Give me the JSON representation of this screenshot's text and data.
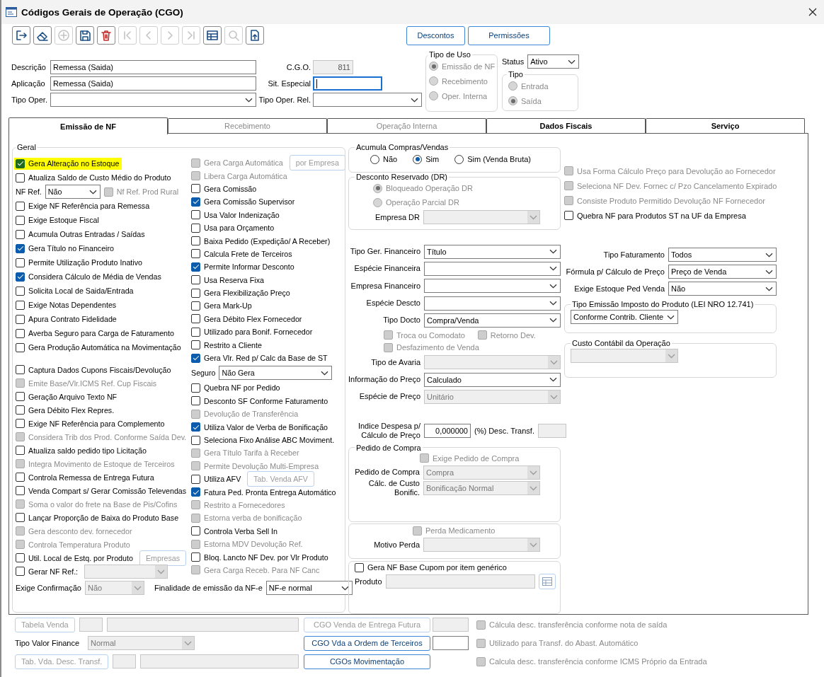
{
  "window": {
    "title": "Códigos Gerais de Operação (CGO)"
  },
  "toolbar": [
    {
      "kind": "exit",
      "disabled": false
    },
    {
      "kind": "eraser",
      "disabled": false
    },
    {
      "kind": "add",
      "disabled": true
    },
    {
      "kind": "save",
      "disabled": false
    },
    {
      "kind": "delete",
      "disabled": false
    },
    {
      "kind": "first",
      "disabled": true
    },
    {
      "kind": "prev",
      "disabled": true
    },
    {
      "kind": "next",
      "disabled": true
    },
    {
      "kind": "last",
      "disabled": true
    },
    {
      "kind": "grid",
      "disabled": false
    },
    {
      "kind": "search",
      "disabled": true
    },
    {
      "kind": "export",
      "disabled": false
    }
  ],
  "header_buttons": [
    {
      "label": "Descontos"
    },
    {
      "label": "Permissões"
    }
  ],
  "header": {
    "descricao": {
      "label": "Descrição",
      "value": "Remessa (Saida)"
    },
    "aplicacao": {
      "label": "Aplicação",
      "value": "Remessa (Saida)"
    },
    "tipo_oper": {
      "label": "Tipo Oper."
    },
    "cgo": {
      "label": "C.G.O.",
      "value": "811",
      "disabled": true
    },
    "sit_especial": {
      "label": "Sit. Especial",
      "focused": true
    },
    "tipo_oper_rel": {
      "label": "Tipo Oper. Rel."
    },
    "tipo_de_uso": {
      "title": "Tipo de Uso",
      "disabled": true,
      "options": [
        {
          "label": "Emissão de NF",
          "selected": true
        },
        {
          "label": "Recebimento",
          "selected": false
        },
        {
          "label": "Oper. Interna",
          "selected": false
        }
      ]
    },
    "status": {
      "label": "Status",
      "value": "Ativo"
    },
    "tipo": {
      "title": "Tipo",
      "disabled": true,
      "options": [
        {
          "label": "Entrada",
          "selected": false
        },
        {
          "label": "Saída",
          "selected": true
        }
      ]
    }
  },
  "tabs": [
    {
      "label": "Emissão de NF",
      "selected": true,
      "disabled": false
    },
    {
      "label": "Recebimento",
      "selected": false,
      "disabled": true
    },
    {
      "label": "Operação Interna",
      "selected": false,
      "disabled": true
    },
    {
      "label": "Dados Fiscais",
      "selected": false,
      "disabled": false
    },
    {
      "label": "Serviço",
      "selected": false,
      "disabled": false
    }
  ],
  "geral": {
    "title": "Geral",
    "column_1": [
      {
        "kind": "check",
        "label": "Gera Alteração no Estoque",
        "checked": true,
        "disabled": false,
        "highlighted": true
      },
      {
        "kind": "check",
        "label": "Atualiza Saldo de Custo Médio do Produto",
        "checked": false,
        "disabled": false,
        "highlighted": false
      },
      {
        "kind": "combo",
        "label": "NF Ref.",
        "value": "Não",
        "disabled": false,
        "check": {
          "label": "Nf Ref. Prod Rural",
          "checked": false,
          "disabled": true
        }
      },
      {
        "kind": "check",
        "label": "Exige NF Referência para Remessa",
        "checked": false,
        "disabled": false,
        "highlighted": false
      },
      {
        "kind": "check",
        "label": "Exige Estoque Fiscal",
        "checked": false,
        "disabled": false,
        "highlighted": false
      },
      {
        "kind": "check",
        "label": "Acumula Outras Entradas / Saídas",
        "checked": false,
        "disabled": false,
        "highlighted": false
      },
      {
        "kind": "check",
        "label": "Gera Título no Financeiro",
        "checked": true,
        "disabled": false,
        "highlighted": false
      },
      {
        "kind": "check",
        "label": "Permite Utilização Produto Inativo",
        "checked": false,
        "disabled": false,
        "highlighted": false
      },
      {
        "kind": "check",
        "label": "Considera Cálculo de Média de Vendas",
        "checked": true,
        "disabled": false,
        "highlighted": false
      },
      {
        "kind": "check",
        "label": "Solicita Local de Saida/Entrada",
        "checked": false,
        "disabled": false,
        "highlighted": false
      },
      {
        "kind": "check",
        "label": "Exige Notas Dependentes",
        "checked": false,
        "disabled": false,
        "highlighted": false
      },
      {
        "kind": "check",
        "label": "Apura Contrato Fidelidade",
        "checked": false,
        "disabled": false,
        "highlighted": false
      },
      {
        "kind": "check",
        "label": "Averba Seguro para Carga de Faturamento",
        "checked": false,
        "disabled": false,
        "highlighted": false
      },
      {
        "kind": "check",
        "label": "Gera Produção Automática na Movimentação",
        "checked": false,
        "disabled": false,
        "highlighted": false
      },
      {
        "kind": "check",
        "label": "Captura Dados Cupons Fiscais/Devolução",
        "checked": false,
        "disabled": false,
        "highlighted": false
      },
      {
        "kind": "check",
        "label": "Emite Base/Vlr.ICMS Ref. Cup Fiscais",
        "checked": false,
        "disabled": true,
        "highlighted": false
      },
      {
        "kind": "check",
        "label": "Geração Arquivo Texto NF",
        "checked": false,
        "disabled": false,
        "highlighted": false
      },
      {
        "kind": "check",
        "label": "Gera Débito Flex Repres.",
        "checked": false,
        "disabled": false,
        "highlighted": false
      },
      {
        "kind": "check",
        "label": "Exige NF Referência para Complemento",
        "checked": false,
        "disabled": false,
        "highlighted": false
      },
      {
        "kind": "check",
        "label": "Considera Trib dos Prod. Conforme Saída Dev.",
        "checked": false,
        "disabled": true,
        "highlighted": false
      },
      {
        "kind": "check",
        "label": "Atualiza saldo pedido tipo Licitação",
        "checked": false,
        "disabled": false,
        "highlighted": false
      },
      {
        "kind": "check",
        "label": "Integra Movimento de Estoque de Terceiros",
        "checked": false,
        "disabled": true,
        "highlighted": false
      },
      {
        "kind": "check",
        "label": "Controla Remessa de Entrega Futura",
        "checked": false,
        "disabled": false,
        "highlighted": false
      },
      {
        "kind": "check",
        "label": "Venda Compart s/ Gerar Comissão Televendas",
        "checked": false,
        "disabled": false,
        "highlighted": false
      },
      {
        "kind": "check",
        "label": "Soma o valor do frete na Base de Pis/Cofins",
        "checked": false,
        "disabled": true,
        "highlighted": false
      },
      {
        "kind": "check",
        "label": "Lançar Proporção de Baixa do Produto Base",
        "checked": false,
        "disabled": false,
        "highlighted": false
      },
      {
        "kind": "check",
        "label": "Gera desconto dev. fornecedor",
        "checked": false,
        "disabled": true,
        "highlighted": false
      },
      {
        "kind": "check",
        "label": "Controla Temperatura Produto",
        "checked": false,
        "disabled": true,
        "highlighted": false
      },
      {
        "kind": "check",
        "label": "Util. Local de Estq. por Produto",
        "checked": false,
        "disabled": false,
        "highlighted": false,
        "button": {
          "label": "Empresas",
          "disabled": true
        }
      },
      {
        "kind": "check",
        "label": "Gerar NF Ref.:",
        "checked": false,
        "disabled": false,
        "highlighted": false,
        "combo": {
          "disabled": true
        }
      }
    ],
    "column_2": [
      {
        "kind": "check",
        "label": "Gera Carga Automática",
        "checked": false,
        "disabled": true,
        "button": {
          "label": "por Empresa",
          "disabled": true
        }
      },
      {
        "kind": "check",
        "label": "Libera Carga Automática",
        "checked": false,
        "disabled": true
      },
      {
        "kind": "check",
        "label": "Gera Comissão",
        "checked": false,
        "disabled": false
      },
      {
        "kind": "check",
        "label": "Gera Comissão Supervisor",
        "checked": true,
        "disabled": false
      },
      {
        "kind": "check",
        "label": "Usa Valor Indenização",
        "checked": false,
        "disabled": false
      },
      {
        "kind": "check",
        "label": "Usa para Orçamento",
        "checked": false,
        "disabled": false
      },
      {
        "kind": "check",
        "label": "Baixa Pedido (Expedição/ A Receber)",
        "checked": false,
        "disabled": false
      },
      {
        "kind": "check",
        "label": "Calcula Frete de Terceiros",
        "checked": false,
        "disabled": false
      },
      {
        "kind": "check",
        "label": "Permite Informar Desconto",
        "checked": true,
        "disabled": false
      },
      {
        "kind": "check",
        "label": "Usa Reserva Fixa",
        "checked": false,
        "disabled": false
      },
      {
        "kind": "check",
        "label": "Gera Flexibilização Preço",
        "checked": false,
        "disabled": false
      },
      {
        "kind": "check",
        "label": "Gera Mark-Up",
        "checked": false,
        "disabled": false
      },
      {
        "kind": "check",
        "label": "Gera Débito Flex Fornecedor",
        "checked": false,
        "disabled": false
      },
      {
        "kind": "check",
        "label": "Utilizado para Bonif. Fornecedor",
        "checked": false,
        "disabled": false
      },
      {
        "kind": "check",
        "label": "Restrito a Cliente",
        "checked": false,
        "disabled": false
      },
      {
        "kind": "check",
        "label": "Gera Vlr. Red p/ Calc da Base de ST",
        "checked": true,
        "disabled": false
      },
      {
        "kind": "combo",
        "label": "Seguro",
        "value": "Não Gera",
        "disabled": false
      },
      {
        "kind": "check",
        "label": "Quebra NF por Pedido",
        "checked": false,
        "disabled": false
      },
      {
        "kind": "check",
        "label": "Desconto SF Conforme Faturamento",
        "checked": false,
        "disabled": false
      },
      {
        "kind": "check",
        "label": "Devolução de Transferência",
        "checked": false,
        "disabled": true
      },
      {
        "kind": "check",
        "label": "Utiliza Valor de Verba de Bonificação",
        "checked": true,
        "disabled": false
      },
      {
        "kind": "check",
        "label": "Seleciona Fixo Análise ABC Moviment.",
        "checked": false,
        "disabled": false
      },
      {
        "kind": "check",
        "label": "Gera Título Tarifa à Receber",
        "checked": false,
        "disabled": true
      },
      {
        "kind": "check",
        "label": "Permite Devolução Multi-Empresa",
        "checked": false,
        "disabled": true
      },
      {
        "kind": "check",
        "label": "Utiliza AFV",
        "checked": false,
        "disabled": false,
        "button": {
          "label": "Tab. Venda AFV",
          "disabled": true
        }
      },
      {
        "kind": "check",
        "label": "Fatura Ped. Pronta Entrega Automático",
        "checked": true,
        "disabled": false
      },
      {
        "kind": "check",
        "label": "Restrito a Fornecedores",
        "checked": false,
        "disabled": true
      },
      {
        "kind": "check",
        "label": "Estorna verba de bonificação",
        "checked": false,
        "disabled": true
      },
      {
        "kind": "check",
        "label": "Controla Verba Sell In",
        "checked": false,
        "disabled": false
      },
      {
        "kind": "check",
        "label": "Estorna MDV Devolução Ref.",
        "checked": false,
        "disabled": true
      },
      {
        "kind": "check",
        "label": "Bloq. Lancto NF Dev. por Vlr Produto",
        "checked": false,
        "disabled": false
      },
      {
        "kind": "check",
        "label": "Gera Carga Receb. Para NF Canc",
        "checked": false,
        "disabled": true
      }
    ],
    "footer": [
      {
        "kind": "combo",
        "label": "Exige Confirmação",
        "value": "Não",
        "disabled": true
      },
      {
        "kind": "combo",
        "label": "Finalidade de emissão da NF-e",
        "value": "NF-e normal",
        "disabled": false
      }
    ]
  },
  "column_3": [
    {
      "kind": "group",
      "title": "Acumula Compras/Vendas",
      "items": [
        {
          "kind": "radio-row",
          "disabled": false,
          "options": [
            {
              "label": "Não",
              "selected": false
            },
            {
              "label": "Sim",
              "selected": true
            },
            {
              "label": "Sim (Venda Bruta)",
              "selected": false
            }
          ]
        }
      ]
    },
    {
      "kind": "group",
      "title": "Desconto Reservado (DR)",
      "items": [
        {
          "kind": "radio-list",
          "disabled": true,
          "options": [
            {
              "label": "Bloqueado Operação DR",
              "selected": true
            },
            {
              "label": "Operação Parcial DR",
              "selected": false
            }
          ]
        },
        {
          "kind": "combo",
          "label": "Empresa DR",
          "disabled": true
        }
      ]
    },
    {
      "kind": "combo",
      "label": "Tipo Ger. Financeiro",
      "value": "Título",
      "disabled": false
    },
    {
      "kind": "combo",
      "label": "Espécie Financeira",
      "disabled": false
    },
    {
      "kind": "combo",
      "label": "Empresa Financeiro",
      "disabled": false
    },
    {
      "kind": "combo",
      "label": "Espécie Descto",
      "disabled": false
    },
    {
      "kind": "combo",
      "label": "Tipo Docto",
      "value": "Compra/Venda",
      "disabled": false
    },
    {
      "kind": "row",
      "items": [
        {
          "kind": "check",
          "label": "Troca ou Comodato",
          "checked": false,
          "disabled": true
        },
        {
          "kind": "check",
          "label": "Retorno Dev.",
          "checked": false,
          "disabled": true
        }
      ]
    },
    {
      "kind": "row",
      "items": [
        {
          "kind": "check",
          "label": "Desfazimento de Venda",
          "checked": false,
          "disabled": true
        }
      ]
    },
    {
      "kind": "combo",
      "label": "Tipo de Avaria",
      "disabled": true
    },
    {
      "kind": "combo",
      "label": "Informação do Preço",
      "value": "Calculado",
      "disabled": false
    },
    {
      "kind": "combo",
      "label": "Espécie de Preço",
      "value": "Unitário",
      "disabled": true
    },
    {
      "kind": "field",
      "label": "Indice Despesa p/ Cálculo de Preço",
      "value": "0,000000",
      "disabled": false,
      "after": {
        "label": "(%) Desc. Transf.",
        "disabled": true
      }
    },
    {
      "kind": "group",
      "title": "Pedido de Compra",
      "items": [
        {
          "kind": "check",
          "label": "Exige Pedido de Compra",
          "checked": false,
          "disabled": true
        },
        {
          "kind": "combo",
          "label": "Pedido de Compra",
          "value": "Compra",
          "disabled": true
        },
        {
          "kind": "combo",
          "label": "Cálc. de Custo Bonific.",
          "value": "Bonificação Normal",
          "disabled": true
        }
      ]
    },
    {
      "kind": "group",
      "items": [
        {
          "kind": "check",
          "label": "Perda Medicamento",
          "checked": false,
          "disabled": true
        },
        {
          "kind": "combo",
          "label": "Motivo Perda",
          "disabled": true
        }
      ]
    },
    {
      "kind": "group",
      "items": [
        {
          "kind": "check",
          "label": "Gera NF Base Cupom por item genérico",
          "checked": false,
          "disabled": false
        },
        {
          "kind": "field",
          "label": "Produto",
          "disabled": true,
          "picker": true
        }
      ]
    }
  ],
  "column_4": [
    {
      "kind": "check",
      "label": "Usa Forma Cálculo Preço para Devolução ao Fornecedor",
      "checked": false,
      "disabled": true
    },
    {
      "kind": "check",
      "label": "Seleciona NF Dev. Fornec c/ Pzo Cancelamento Expirado",
      "checked": false,
      "disabled": true
    },
    {
      "kind": "check",
      "label": "Consiste Produto Permitido Devolução NF Fornecedor",
      "checked": false,
      "disabled": true
    },
    {
      "kind": "check",
      "label": "Quebra NF para Produtos ST na UF da Empresa",
      "checked": false,
      "disabled": false
    },
    {
      "kind": "combo",
      "label": "Tipo Faturamento",
      "value": "Todos",
      "disabled": false
    },
    {
      "kind": "combo",
      "label": "Fórmula p/ Cálculo de Preço",
      "value": "Preço de Venda",
      "disabled": false
    },
    {
      "kind": "combo",
      "label": "Exige Estoque Ped Venda",
      "value": "Não",
      "disabled": false
    },
    {
      "kind": "group",
      "title": "Tipo Emissão Imposto do Produto (LEI NRO 12.741)",
      "items": [
        {
          "kind": "combo",
          "value": "Conforme Contrib. Cliente",
          "disabled": false
        }
      ]
    },
    {
      "kind": "group",
      "title": "Custo Contábil da Operação",
      "items": [
        {
          "kind": "combo",
          "disabled": true
        }
      ]
    }
  ],
  "bottom": {
    "left": [
      {
        "kind": "lookup",
        "button": {
          "label": "Tabela Venda",
          "disabled": true
        },
        "fields": [
          {
            "disabled": true
          },
          {
            "disabled": true
          }
        ]
      },
      {
        "kind": "combo",
        "label": "Tipo Valor Finance",
        "value": "Normal",
        "disabled": true
      },
      {
        "kind": "lookup",
        "button": {
          "label": "Tab. Vda. Desc. Transf.",
          "disabled": true
        },
        "fields": [
          {
            "disabled": true
          },
          {
            "disabled": true
          }
        ]
      }
    ],
    "middle": [
      {
        "kind": "button-field",
        "button": {
          "label": "CGO Venda de Entrega Futura",
          "disabled": true
        },
        "field": {
          "disabled": true
        }
      },
      {
        "kind": "button-field",
        "button": {
          "label": "CGO Vda a Ordem de Terceiros",
          "disabled": false
        },
        "field": {
          "disabled": false
        }
      },
      {
        "kind": "button-field",
        "button": {
          "label": "CGOs Movimentação",
          "disabled": false
        }
      }
    ],
    "right": [
      {
        "kind": "check",
        "label": "Cálcula desc. transferência conforme nota de saída",
        "checked": false,
        "disabled": true
      },
      {
        "kind": "check",
        "label": "Utilizado para Transf. do Abast. Automático",
        "checked": false,
        "disabled": true
      },
      {
        "kind": "check",
        "label": "Calcula desc. transferência conforme ICMS Próprio da Entrada",
        "checked": false,
        "disabled": true
      }
    ]
  }
}
